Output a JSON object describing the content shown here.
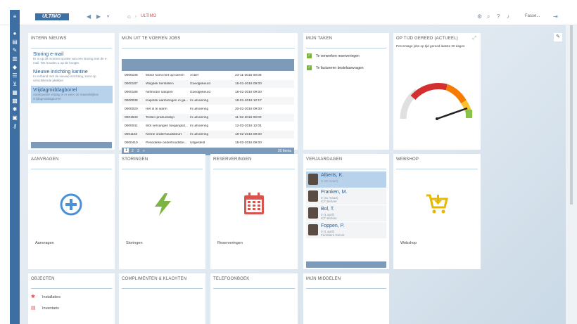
{
  "header": {
    "logo_text": "ULTIMO",
    "breadcrumb": "ULTIMO",
    "user_label": "Fasse..."
  },
  "tiles": {
    "news": {
      "title": "INTERN NIEUWS",
      "items": [
        {
          "heading": "Storing e-mail",
          "body": "Er is op dit moment sprake van een storing met de e-mail. We houden u op de hoogte."
        },
        {
          "heading": "Nieuwe inrichting kantine",
          "body": "In verband met de nieuwe inrichting, komt op verschillende plekken"
        },
        {
          "heading": "Vrijdagmiddagborrel",
          "body": "Aanstaande vrijdag is er weer de maandelijkse vrijdagmiddagborrel"
        }
      ]
    },
    "jobs": {
      "title": "MIJN UIT TE VOEREN JOBS",
      "rows": [
        [
          "0000108",
          "Motor komt niet op toeren",
          "Actief",
          "23-11-2015 08:08"
        ],
        [
          "0000187",
          "Wegdek herstellen",
          "Goedgekeurd",
          "15-01-2016 09:00"
        ],
        [
          "0000188",
          "heftmotor nalopen",
          "Goedgekeurd",
          "18-01-2016 09:00"
        ],
        [
          "0000038",
          "Kapotok aanbrengen in ga...",
          "In uitvoering",
          "18-01-2016 12:17"
        ],
        [
          "0000020",
          "Het is te warm",
          "In uitvoering",
          "20-01-2016 09:00"
        ],
        [
          "0001533",
          "Testen productielijn",
          "In uitvoering",
          "11-02-2016 08:00"
        ],
        [
          "0000041",
          "Slot vervangen toegangsd...",
          "In uitvoering",
          "12-02-2016 12:01"
        ],
        [
          "0001164",
          "Kleine onderhoudsbeurt",
          "In uitvoering",
          "18-02-2016 09:00"
        ],
        [
          "0000410",
          "Periodieke onderhoudsbe...",
          "Uitgesteld",
          "15-02-2016 09:00"
        ]
      ],
      "pages": [
        "1",
        "2",
        "3",
        "»"
      ],
      "count": "20 Items"
    },
    "tasks": {
      "title": "MIJN TAKEN",
      "items": [
        "Te verwerken reserveringen",
        "Te factureren bestelaanvragen"
      ]
    },
    "ontime": {
      "title": "OP TIJD GEREED (ACTUEEL)",
      "subtitle": "Percentage jobs op tijd gereed laatste 30 dagen"
    },
    "requests": {
      "title": "AANVRAGEN",
      "label": "Aanvragen"
    },
    "failures": {
      "title": "STORINGEN",
      "label": "Storingen"
    },
    "reservations": {
      "title": "RESERVERINGEN",
      "label": "Reserveringen"
    },
    "birthdays": {
      "title": "VERJAARDAGEN",
      "people": [
        {
          "name": "Alberts, K.",
          "d1": "0 (30 maart)",
          "d2": ""
        },
        {
          "name": "Franken, M.",
          "d1": "0 (31 maart)",
          "d2": "ICT Beheer"
        },
        {
          "name": "Bol, T.",
          "d1": "0 (1 april)",
          "d2": "ICT Beheer"
        },
        {
          "name": "Foppen, P.",
          "d1": "0 (1 april)",
          "d2": "Facilitaire Dienst"
        }
      ]
    },
    "webshop": {
      "title": "WEBSHOP",
      "label": "Webshop"
    },
    "objects": {
      "title": "OBJECTEN",
      "rows": [
        "Installaties",
        "Inventaris"
      ]
    },
    "compliments": {
      "title": "COMPLIMENTEN & KLACHTEN"
    },
    "phonebook": {
      "title": "TELEFOONBOEK"
    },
    "resources": {
      "title": "MIJN MIDDELEN"
    }
  },
  "colors": {
    "primary": "#3d6fa3",
    "accent_blue": "#4a90d9",
    "accent_green": "#7cb342",
    "accent_red": "#d9534f",
    "accent_yellow": "#e6b800"
  }
}
